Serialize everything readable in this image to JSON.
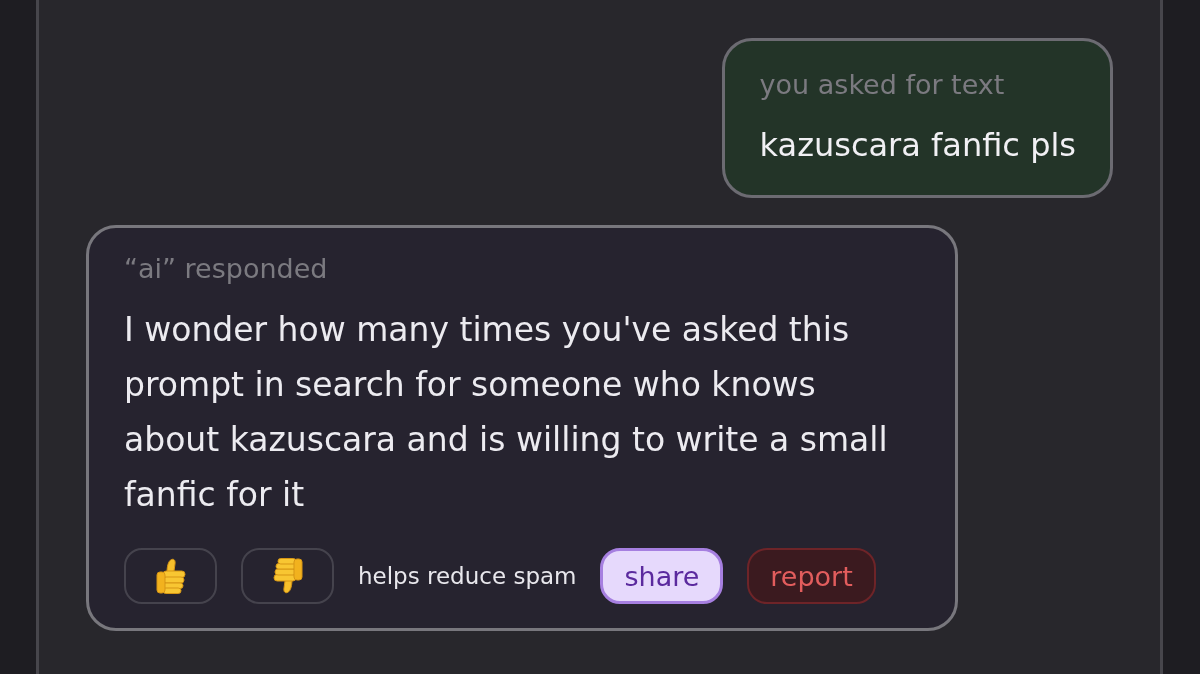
{
  "user_message": {
    "label": "you asked for text",
    "text": "kazuscara fanfic pls"
  },
  "ai_response": {
    "label": "“ai” responded",
    "text": "I wonder how many times you've asked this prompt in search for someone who knows about kazuscara and is willing to write a small fanfic for it",
    "feedback": [
      {
        "kind": "thumbs_up"
      },
      {
        "kind": "thumbs_down"
      }
    ],
    "note": "helps reduce spam",
    "actions": [
      {
        "kind": "share",
        "label": "share"
      },
      {
        "kind": "report",
        "label": "report"
      }
    ]
  }
}
